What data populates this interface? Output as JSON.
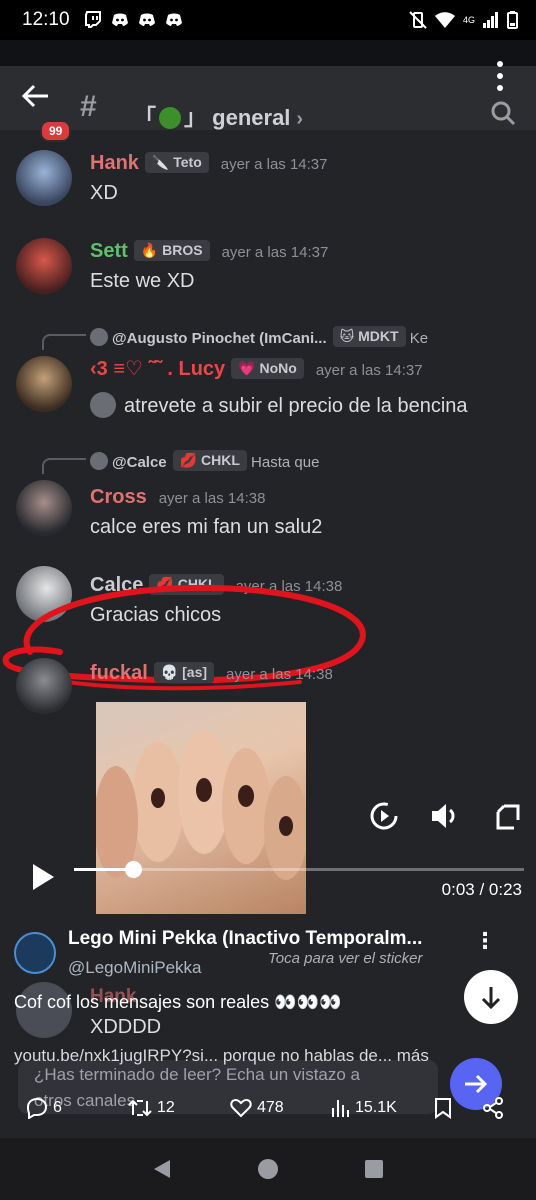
{
  "status_bar": {
    "time": "12:10",
    "network": "4G"
  },
  "discord": {
    "unread_count": "99",
    "channel_prefix": "「",
    "channel_suffix": "」",
    "channel_name": "general",
    "chevron": "›"
  },
  "messages": [
    {
      "author": "Hank",
      "tag": "Teto",
      "time": "ayer a las 14:37",
      "text": "XD",
      "color": "#e07272"
    },
    {
      "author": "Sett",
      "tag": "BROS",
      "time": "ayer a las 14:37",
      "text": "Este we XD",
      "color": "#5fbf6a"
    },
    {
      "reply_to": "@Augusto Pinochet (ImCani...",
      "reply_tag": "MDKT",
      "reply_snippet": "Ke",
      "author": "‹3 ≡♡ ˜˜ . Lucy",
      "tag": "NoNo",
      "time": "ayer a las 14:37",
      "text": "atrevete a subir el precio de la bencina",
      "color": "#e84848"
    },
    {
      "reply_to": "@Calce",
      "reply_tag": "CHKL",
      "reply_snippet": "Hasta que",
      "author": "Cross",
      "time": "ayer a las 14:38",
      "text": "calce eres mi fan un salu2",
      "color": "#e07272"
    },
    {
      "author": "Calce",
      "tag": "CHKL",
      "time": "ayer a las 14:38",
      "text": "Gracias chicos",
      "color": "#c9cbd0"
    },
    {
      "author": "fuckal",
      "tag": "[as]",
      "time": "ayer a las 14:38",
      "color": "#e07272"
    }
  ],
  "video": {
    "current": "0:03",
    "total": "0:23",
    "separator": " / ",
    "progress": 0.13
  },
  "tweet": {
    "author": "Lego Mini Pekka (Inactivo Temporalm...",
    "handle": "@LegoMiniPekka",
    "text": "Cof cof los mensajes son reales 👀👀👀",
    "link": "youtu.be/nxk1jugIRPY?si... porque no hablas de... más",
    "sticker_hint": "Toca para ver el sticker",
    "bg_author": "Hank",
    "bg_text": "XDDDD",
    "read_prompt": "¿Has terminado de leer? Echa un vistazo a otros canales",
    "replies": "6",
    "retweets": "12",
    "likes": "478",
    "views": "15.1K"
  },
  "icons": [
    "back-arrow-icon",
    "search-icon",
    "kebab-icon",
    "play-icon",
    "volume-icon",
    "replay-icon",
    "rotate-icon",
    "reply-icon",
    "retweet-icon",
    "heart-icon",
    "views-icon",
    "bookmark-icon",
    "share-icon",
    "arrow-down-icon",
    "arrow-right-icon"
  ]
}
